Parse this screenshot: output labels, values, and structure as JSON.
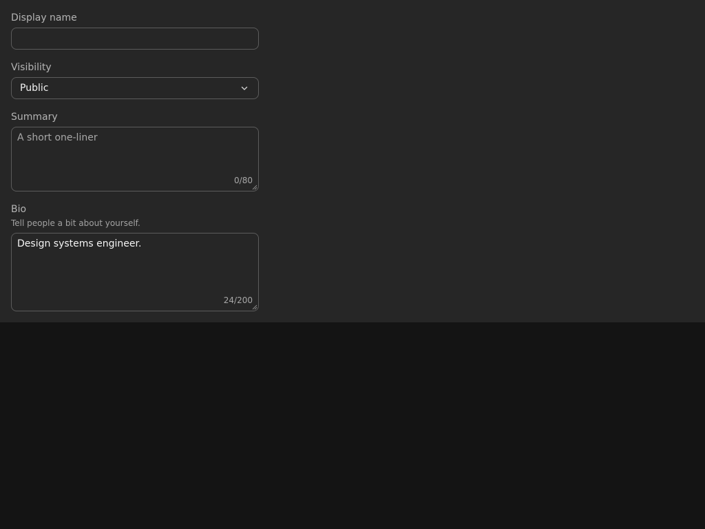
{
  "form": {
    "display_name": {
      "label": "Display name",
      "value": ""
    },
    "visibility": {
      "label": "Visibility",
      "selected": "Public",
      "icon": "chevron-down-icon"
    },
    "summary": {
      "label": "Summary",
      "placeholder": "A short one-liner",
      "value": "",
      "counter": "0/80"
    },
    "bio": {
      "label": "Bio",
      "hint": "Tell people a bit about yourself.",
      "value": "Design systems engineer.",
      "counter": "24/200"
    }
  },
  "colors": {
    "panel_bg": "#262626",
    "page_bg": "#141414",
    "border": "#5c5c5c"
  }
}
